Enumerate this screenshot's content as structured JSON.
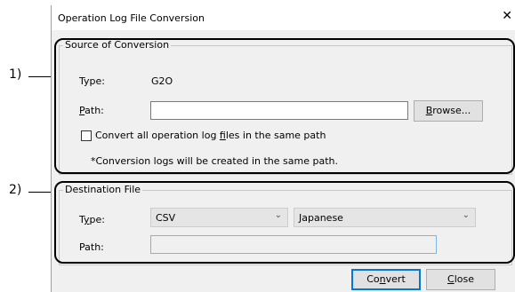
{
  "dialog": {
    "title": "Operation Log File Conversion",
    "close_glyph": "✕"
  },
  "source": {
    "group_label": "Source of Conversion",
    "type_label": "Type:",
    "type_value": "G2O",
    "path_label_u": "P",
    "path_label_rest": "ath:",
    "path_value": "",
    "browse_u": "B",
    "browse_rest": "rowse...",
    "convert_all_pre": "Convert all operation log ",
    "convert_all_u": "f",
    "convert_all_post": "iles in the same path",
    "convert_all_checked": false,
    "note": "*Conversion logs will be created in the same path."
  },
  "destination": {
    "group_label": "Destination File",
    "type_label_pre": "T",
    "type_label_u": "y",
    "type_label_post": "pe:",
    "format_selected": "CSV",
    "language_selected": "Japanese",
    "path_label": "Path:",
    "path_value": ""
  },
  "buttons": {
    "convert_pre": "Co",
    "convert_u": "n",
    "convert_post": "vert",
    "close_u": "C",
    "close_rest": "lose"
  },
  "annotations": {
    "label_1": "1)",
    "label_2": "2)"
  },
  "icons": {
    "close": "close-icon",
    "chevron": "chevron-down-icon"
  }
}
